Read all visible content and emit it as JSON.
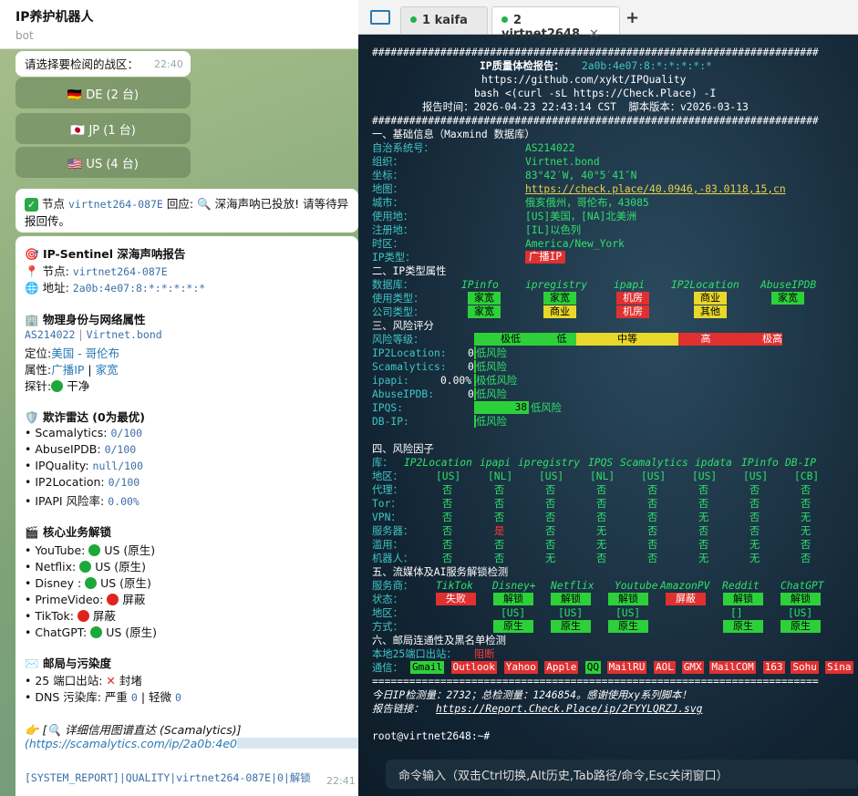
{
  "chat": {
    "title": "IP养护机器人",
    "subtitle": "bot",
    "m1_text": "请选择要检阅的战区：",
    "m1_time": "22:40",
    "kb": [
      "🇩🇪 DE (2 台)",
      "🇯🇵 JP (1 台)",
      "🇺🇸 US (4 台)"
    ],
    "m2_a": "节点",
    "m2_node": "virtnet264-087E",
    "m2_b": "回应:",
    "m2_c": "深海声呐已投放! 请等待异",
    "m2_d": "报回传。",
    "r_title": "IP-Sentinel 深海声呐报告",
    "r_node_l": "节点:",
    "r_node": "virtnet264-087E",
    "r_addr_l": "地址:",
    "r_addr": "2a0b:4e07:8:*:*:*:*:*",
    "s1": "物理身份与网络属性",
    "asn": "AS214022",
    "org": "Virtnet.bond",
    "loc_l": "定位:",
    "loc": "美国 - 哥伦布",
    "attr_l": "属性:",
    "attr1": "广播IP",
    "attr2": "家宽",
    "probe_l": "探针:",
    "probe": "干净",
    "s2": "欺诈雷达 (0为最优)",
    "fraud": [
      {
        "k": "• Scamalytics:",
        "v": "0/100"
      },
      {
        "k": "• AbuseIPDB:",
        "v": "0/100"
      },
      {
        "k": "• IPQuality:",
        "v": "null/100"
      },
      {
        "k": "• IP2Location:",
        "v": "0/100"
      },
      {
        "k": "• IPAPI 风险率:",
        "v": "0.00%"
      }
    ],
    "s3": "核心业务解锁",
    "svc": [
      {
        "k": "• YouTube:",
        "s": "g",
        "v": "US (原生)"
      },
      {
        "k": "• Netflix:",
        "s": "g",
        "v": "US (原生)"
      },
      {
        "k": "• Disney :",
        "s": "g",
        "v": "US (原生)"
      },
      {
        "k": "• PrimeVideo:",
        "s": "r",
        "v": "屏蔽"
      },
      {
        "k": "• TikTok:",
        "s": "r",
        "v": "屏蔽"
      },
      {
        "k": "• ChatGPT:",
        "s": "g",
        "v": "US (原生)"
      }
    ],
    "s4": "邮局与污染度",
    "port_l": "• 25 端口出站:",
    "port": "封堵",
    "dns_l": "• DNS 污染库: 严重",
    "dns_a": "0",
    "dns_m": "| 轻微",
    "dns_b": "0",
    "link_t": "详细信用图谱直达 (Scamalytics)]",
    "link_u": "(https://scamalytics.com/ip/2a0b:4e0",
    "footer": "[SYSTEM_REPORT]|QUALITY|virtnet264-087E|0|解锁",
    "footer_time": "22:41"
  },
  "terminal": {
    "tab1": "1 kaifa",
    "tab2": "2 virtnet2648",
    "plus": "+",
    "hash": "########################################################################",
    "title": "IP质量体检报告：",
    "title_ip": "2a0b:4e07:8:*:*:*:*:*",
    "github": "https://github.com/xykt/IPQuality",
    "bash": "bash <(curl -sL https://Check.Place) -I",
    "time": "报告时间：2026-04-23 22:43:14 CST  脚本版本：v2026-03-13",
    "sec1": "一、基础信息（Maxmind 数据库）",
    "basic": [
      {
        "k": "自治系统号：",
        "v": "AS214022"
      },
      {
        "k": "组织：",
        "v": "Virtnet.bond"
      },
      {
        "k": "坐标：",
        "v": "83°42′W, 40°5′41″N"
      },
      {
        "k": "地图：",
        "v": "https://check.place/40.0946,-83.0118,15,cn"
      },
      {
        "k": "城市：",
        "v": "俄亥俄州，哥伦布，43085"
      },
      {
        "k": "使用地：",
        "v": "[US]美国，[NA]北美洲"
      },
      {
        "k": "注册地：",
        "v": "[IL]以色列"
      },
      {
        "k": "时区：",
        "v": "America/New_York"
      }
    ],
    "iptype_l": "IP类型：",
    "iptype": "广播IP",
    "sec2": "二、IP类型属性",
    "db_l": "数据库：",
    "dbs": [
      "IPinfo",
      "ipregistry",
      "ipapi",
      "IP2Location",
      "AbuseIPDB"
    ],
    "use_l": "使用类型：",
    "use": [
      {
        "t": "家宽",
        "c": "g"
      },
      {
        "t": "家宽",
        "c": "g"
      },
      {
        "t": "机房",
        "c": "r"
      },
      {
        "t": "商业",
        "c": "y"
      },
      {
        "t": "家宽",
        "c": "g"
      }
    ],
    "co_l": "公司类型：",
    "co": [
      {
        "t": "家宽",
        "c": "g"
      },
      {
        "t": "商业",
        "c": "y"
      },
      {
        "t": "机房",
        "c": "r"
      },
      {
        "t": "其他",
        "c": "y"
      }
    ],
    "sec3": "三、风险评分",
    "risk_l": "风险等级：",
    "risk": [
      "极低",
      "低",
      "中等",
      "高",
      "极高"
    ],
    "scores": [
      {
        "k": "IP2Location:",
        "n": "0",
        "t": "低风险"
      },
      {
        "k": "Scamalytics:",
        "n": "0",
        "t": "低风险"
      },
      {
        "k": "ipapi:",
        "n": "0.00%",
        "t": "极低风险"
      },
      {
        "k": "AbuseIPDB:",
        "n": "0",
        "t": "低风险"
      },
      {
        "k": "IPQS:",
        "n": "38",
        "t": "低风险"
      },
      {
        "k": "DB-IP:",
        "n": "",
        "t": "低风险"
      }
    ],
    "sec4": "四、风险因子",
    "lib_l": "库：",
    "libs": [
      "IP2Location",
      "ipapi",
      "ipregistry",
      "IPQS",
      "Scamalytics",
      "ipdata",
      "IPinfo",
      "DB-IP"
    ],
    "region_l": "地区：",
    "regions": [
      "[US]",
      "[NL]",
      "[US]",
      "[NL]",
      "[US]",
      "[US]",
      "[US]",
      "[CB]"
    ],
    "factors": [
      {
        "k": "代理：",
        "v": [
          "否",
          "否",
          "否",
          "否",
          "否",
          "否",
          "否",
          "否"
        ]
      },
      {
        "k": "Tor：",
        "v": [
          "否",
          "否",
          "否",
          "否",
          "否",
          "否",
          "否",
          "否"
        ]
      },
      {
        "k": "VPN：",
        "v": [
          "否",
          "否",
          "否",
          "否",
          "否",
          "无",
          "否",
          "无"
        ]
      },
      {
        "k": "服务器：",
        "v": [
          "否",
          "是",
          "否",
          "无",
          "否",
          "否",
          "否",
          "无"
        ]
      },
      {
        "k": "滥用：",
        "v": [
          "否",
          "否",
          "否",
          "无",
          "否",
          "否",
          "无",
          "否"
        ]
      },
      {
        "k": "机器人：",
        "v": [
          "否",
          "否",
          "无",
          "否",
          "否",
          "无",
          "无",
          "否"
        ]
      }
    ],
    "sec5": "五、流媒体及AI服务解锁检测",
    "svc_l": "服务商：",
    "svcs": [
      "TikTok",
      "Disney+",
      "Netflix",
      "Youtube",
      "AmazonPV",
      "Reddit",
      "ChatGPT"
    ],
    "st_l": "状态：",
    "st": [
      {
        "t": "失败",
        "c": "r"
      },
      {
        "t": "解锁",
        "c": "g"
      },
      {
        "t": "解锁",
        "c": "g"
      },
      {
        "t": "解锁",
        "c": "g"
      },
      {
        "t": "屏蔽",
        "c": "r"
      },
      {
        "t": "解锁",
        "c": "g"
      },
      {
        "t": "解锁",
        "c": "g"
      }
    ],
    "reg2_l": "地区：",
    "reg2": [
      "",
      "[US]",
      "[US]",
      "[US]",
      "",
      "[]",
      "[US]"
    ],
    "mode_l": "方式：",
    "mode": [
      "",
      "原生",
      "原生",
      "原生",
      "",
      "原生",
      "原生"
    ],
    "sec6": "六、邮局连通性及黑名单检测",
    "port25_l": "本地25端口出站：",
    "port25": "阻断",
    "mail_l": "通信：",
    "mails": [
      "Gmail",
      "Outlook",
      "Yahoo",
      "Apple",
      "QQ",
      "MailRU",
      "AOL",
      "GMX",
      "MailCOM",
      "163",
      "Sohu",
      "Sina"
    ],
    "eq": "========================================================================",
    "stat": "今日IP检测量：2732；总检测量：1246854。感谢使用xy系列脚本！",
    "rep_l": "报告链接：",
    "rep": "https://Report.Check.Place/ip/2FYYLQRZJ.svg",
    "prompt": "root@virtnet2648:~#",
    "cmd": "命令输入（双击Ctrl切换,Alt历史,Tab路径/命令,Esc关闭窗口）"
  },
  "colors": {
    "green": "#2ed03a",
    "red": "#e03030",
    "yellow": "#e8d82a",
    "cyan": "#3fc6c6"
  }
}
